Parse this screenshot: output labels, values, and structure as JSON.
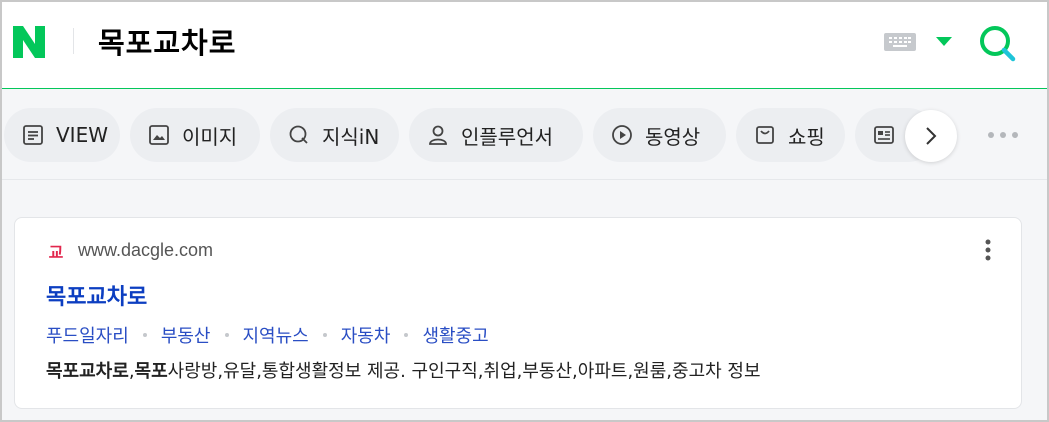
{
  "header": {
    "logo_letter": "N",
    "query": "목포교차로",
    "brand_color": "#03c75a"
  },
  "tabs": [
    {
      "label": "VIEW",
      "icon": "view-icon"
    },
    {
      "label": "이미지",
      "icon": "image-icon"
    },
    {
      "label": "지식iN",
      "icon": "kin-icon"
    },
    {
      "label": "인플루언서",
      "icon": "person-icon"
    },
    {
      "label": "동영상",
      "icon": "play-icon"
    },
    {
      "label": "쇼핑",
      "icon": "shopping-bag-icon"
    },
    {
      "label": "",
      "icon": "news-icon"
    }
  ],
  "result": {
    "url": "www.dacgle.com",
    "favicon_letter": "교",
    "favicon_color": "#e2264d",
    "title": "목포교차로",
    "sublinks": [
      "푸드일자리",
      "부동산",
      "지역뉴스",
      "자동차",
      "생활중고"
    ],
    "desc_bold1": "목포교차로",
    "desc_sep": ",",
    "desc_bold2": "목포",
    "desc_rest": "사랑방,유달,통합생활정보 제공. 구인구직,취업,부동산,아파트,원룸,중고차 정보",
    "link_color": "#0c3ec1"
  }
}
